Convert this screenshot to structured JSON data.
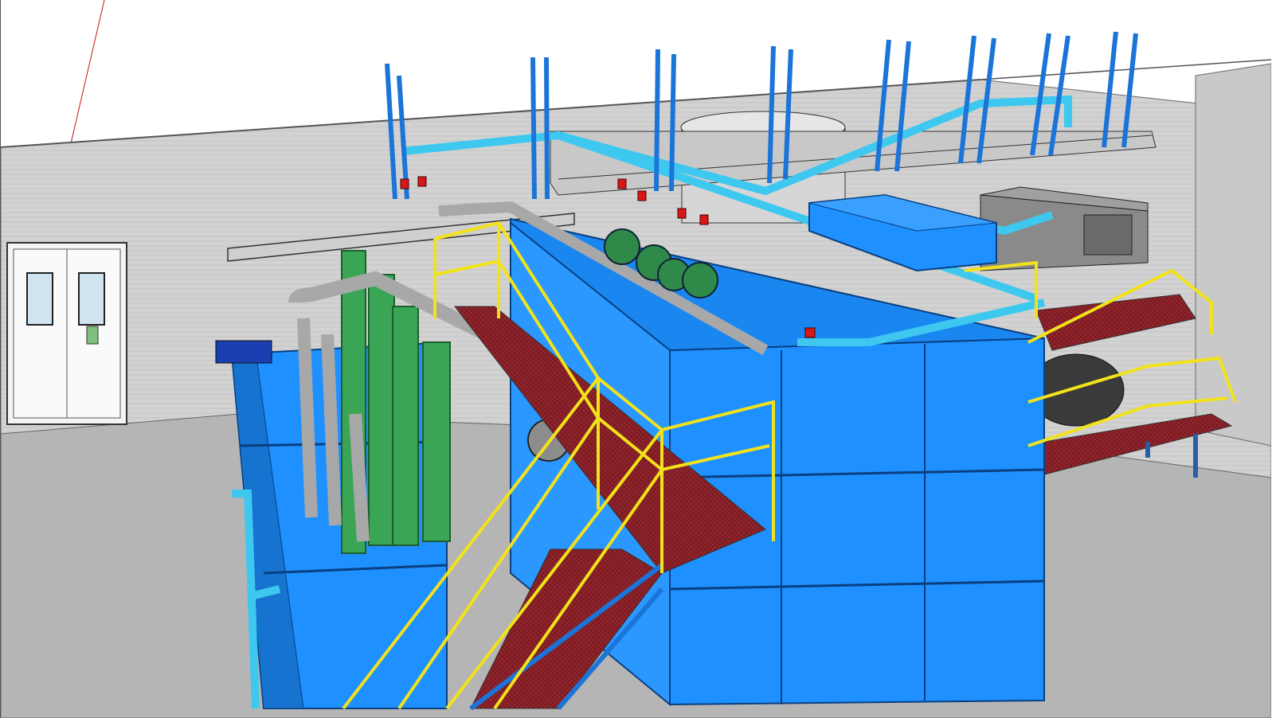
{
  "viewport": {
    "description_tag": "3d-model-viewport",
    "colors": {
      "background": "#ffffff",
      "wall": "#d4d4d4",
      "floor": "#b8b8b8",
      "tank_blue": "#1e90ff",
      "tank_edge": "#0a4f9e",
      "pipe_light_blue": "#3ec8f0",
      "pipe_blue": "#1b74d8",
      "pipe_gray": "#a8a8a8",
      "pipe_green": "#3aa655",
      "railing_yellow": "#f2e21b",
      "grating_red": "#7a1a22",
      "axis_red": "#cc1111"
    }
  }
}
